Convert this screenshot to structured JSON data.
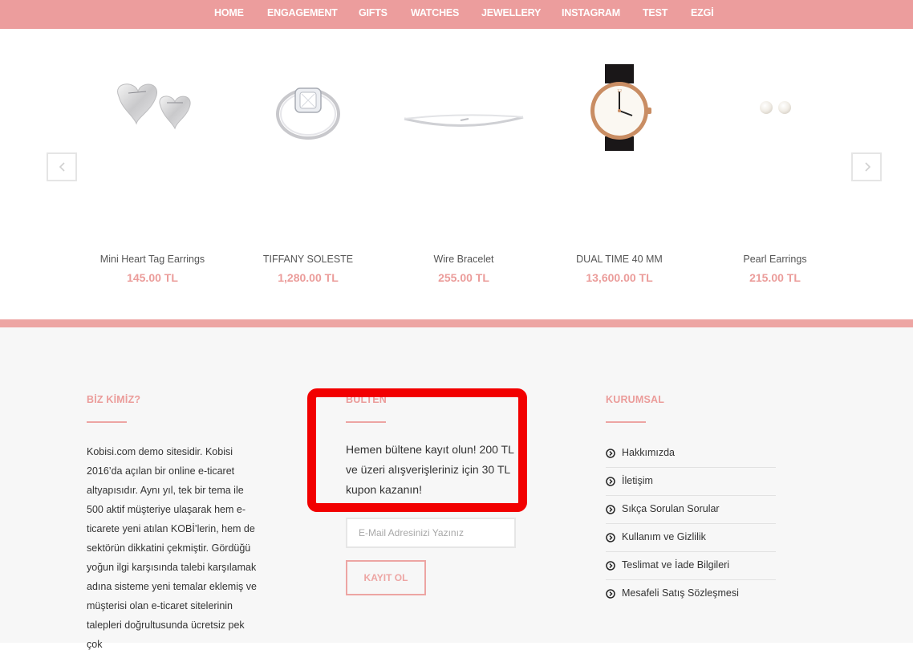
{
  "nav": {
    "items": [
      "HOME",
      "ENGAGEMENT",
      "GIFTS",
      "WATCHES",
      "JEWELLERY",
      "INSTAGRAM",
      "TEST",
      "EZGİ"
    ]
  },
  "carousel": {
    "prev_icon": "chevron-left-icon",
    "next_icon": "chevron-right-icon",
    "products": [
      {
        "name": "Mini Heart Tag Earrings",
        "price": "145.00 TL"
      },
      {
        "name": "TIFFANY SOLESTE",
        "price": "1,280.00 TL"
      },
      {
        "name": "Wire Bracelet",
        "price": "255.00 TL"
      },
      {
        "name": "DUAL TIME 40 MM",
        "price": "13,600.00 TL"
      },
      {
        "name": "Pearl Earrings",
        "price": "215.00 TL"
      }
    ]
  },
  "colors": {
    "brand": "#ec9d9d",
    "accent_text": "#eb9c9a",
    "highlight": "#f20000"
  },
  "footer": {
    "about": {
      "title": "BİZ KİMİZ?",
      "text": "Kobisi.com demo sitesidir. Kobisi 2016’da açılan bir online e-ticaret altyapısıdır. Aynı yıl, tek bir tema ile 500 aktif müşteriye ulaşarak hem e-ticarete yeni atılan KOBİ’lerin, hem de sektörün dikkatini çekmiştir. Gördüğü yoğun ilgi karşısında talebi karşılamak adına sisteme yeni temalar eklemiş ve müşterisi olan e-ticaret sitelerinin talepleri doğrultusunda ücretsiz pek çok"
    },
    "newsletter": {
      "title": "BÜLTEN",
      "text": "Hemen bültene kayıt olun! 200 TL ve üzeri alışverişleriniz için 30 TL kupon kazanın!",
      "email_placeholder": "E-Mail Adresinizi Yazınız",
      "submit_label": "KAYIT OL"
    },
    "corporate": {
      "title": "KURUMSAL",
      "link_icon": "chevron-circle-right-icon",
      "links": [
        "Hakkımızda",
        "İletişim",
        "Sıkça Sorulan Sorular",
        "Kullanım ve Gizlilik",
        "Teslimat ve İade Bilgileri",
        "Mesafeli Satış Sözleşmesi"
      ]
    }
  }
}
